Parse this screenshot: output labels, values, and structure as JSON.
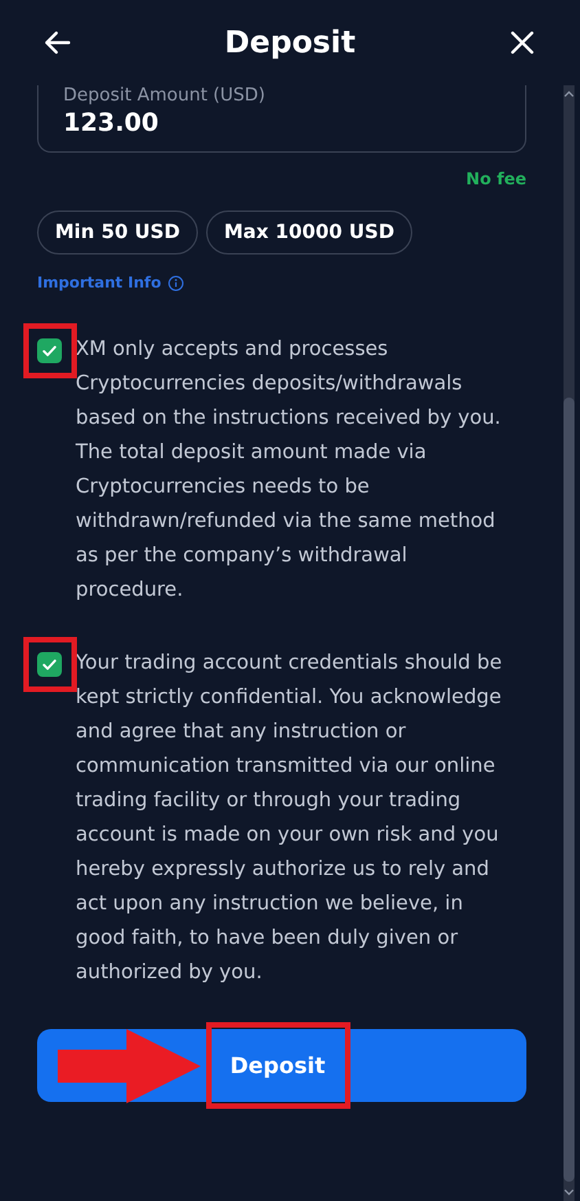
{
  "header": {
    "title": "Deposit"
  },
  "amount_field": {
    "label": "Deposit Amount (USD)",
    "value": "123.00"
  },
  "fee_note": "No fee",
  "limits": [
    "Min 50 USD",
    "Max 10000 USD"
  ],
  "important_info": "Important Info",
  "agreements": [
    {
      "text": "XM only accepts and processes Cryptocurrencies deposits/withdrawals based on the instructions received by you. The total deposit amount made via Cryptocurrencies needs to be withdrawn/refunded via the same method as per the company’s withdrawal procedure.",
      "checked": true
    },
    {
      "text": "Your trading account credentials should be kept strictly confidential. You acknowledge and agree that any instruction or communication transmitted via our online trading facility or through your trading account is made on your own risk and you hereby expressly authorize us to rely and act upon any instruction we believe, in good faith, to have been duly given or authorized by you.",
      "checked": true
    }
  ],
  "submit": "Deposit"
}
